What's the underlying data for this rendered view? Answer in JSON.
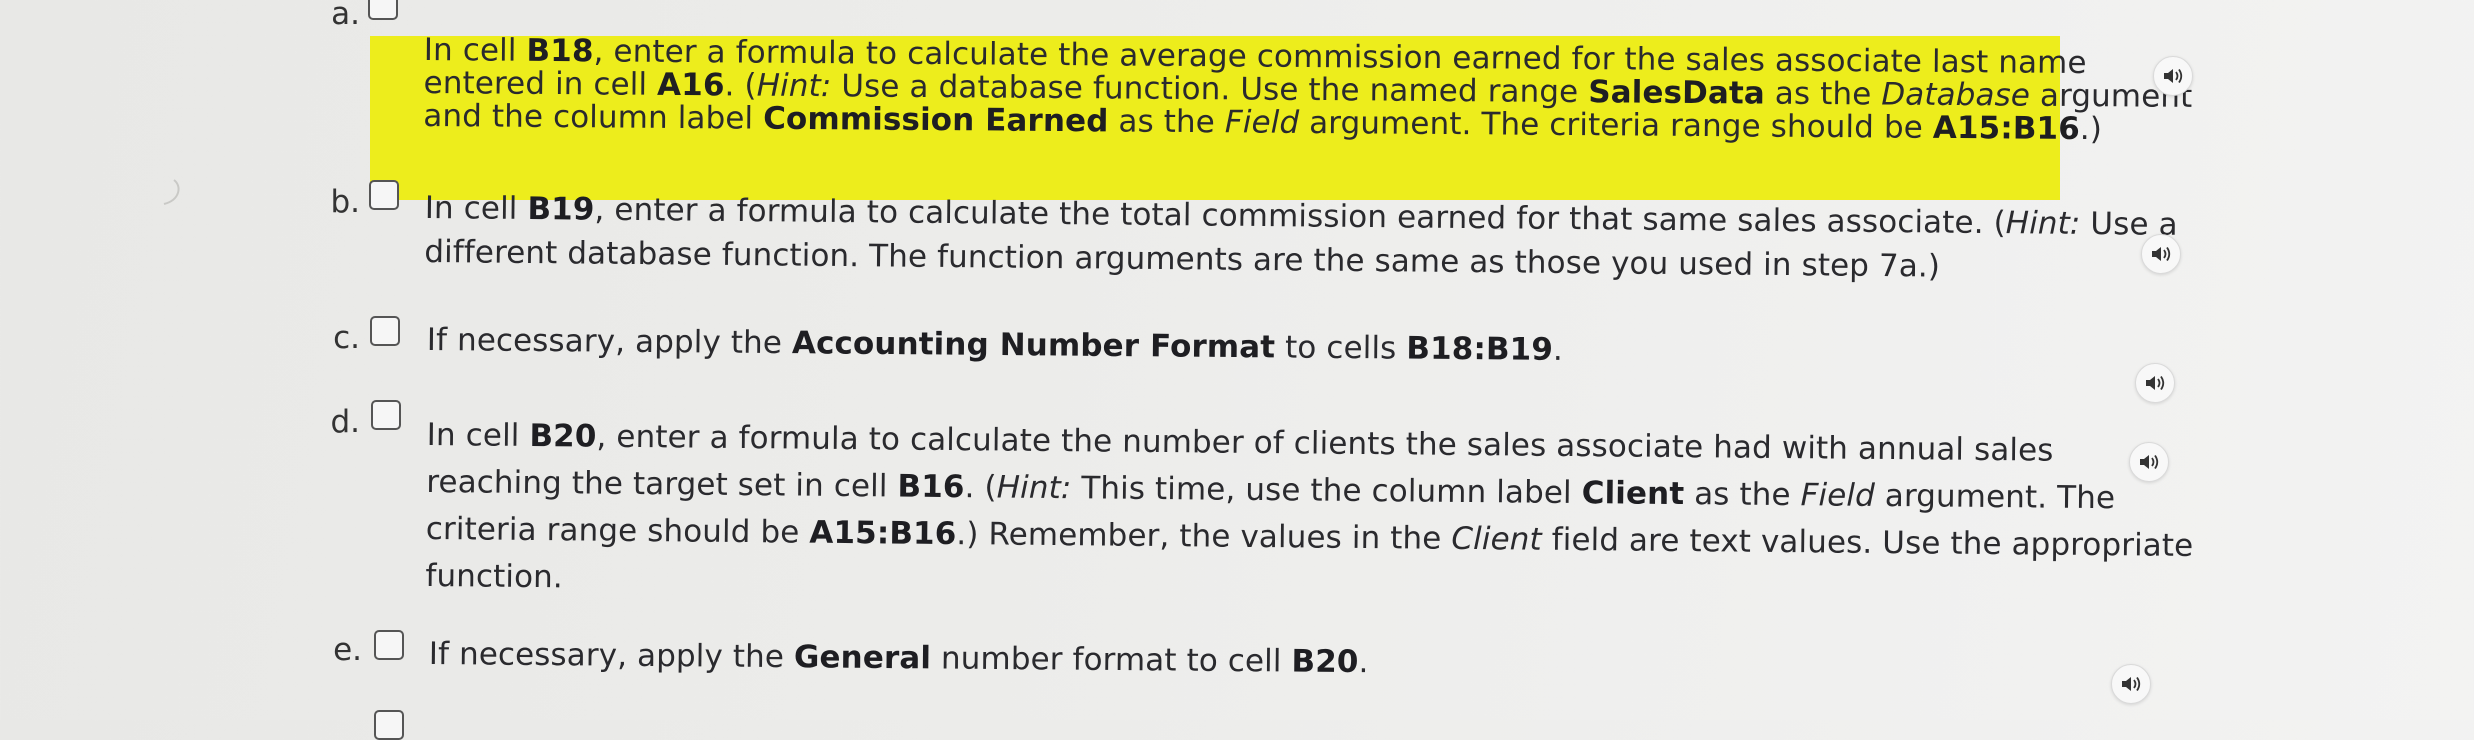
{
  "steps": [
    {
      "marker": "a.",
      "parts": [
        {
          "t": "In cell "
        },
        {
          "t": "B18",
          "b": true
        },
        {
          "t": ", enter a formula to calculate the average commission earned for the sales associate last name"
        },
        {
          "br": true
        },
        {
          "t": "entered in cell "
        },
        {
          "t": "A16",
          "b": true
        },
        {
          "t": ". ("
        },
        {
          "t": "Hint:",
          "i": true
        },
        {
          "t": " Use a database function. Use the named range "
        },
        {
          "t": "SalesData",
          "b": true
        },
        {
          "t": " as the "
        },
        {
          "t": "Database",
          "i": true
        },
        {
          "t": " argument"
        },
        {
          "br": true
        },
        {
          "t": "and the column label "
        },
        {
          "t": "Commission Earned",
          "b": true
        },
        {
          "t": " as the "
        },
        {
          "t": "Field",
          "i": true
        },
        {
          "t": " argument. The criteria range should be "
        },
        {
          "t": "A15:B16",
          "b": true
        },
        {
          "t": ".)"
        }
      ]
    },
    {
      "marker": "b.",
      "parts": [
        {
          "t": "In cell "
        },
        {
          "t": "B19",
          "b": true
        },
        {
          "t": ", enter a formula to calculate the total commission earned for that same sales associate. ("
        },
        {
          "t": "Hint:",
          "i": true
        },
        {
          "t": " Use a"
        },
        {
          "br": true
        },
        {
          "t": "different database function. The function arguments are the same as those you used in step 7a.)"
        }
      ]
    },
    {
      "marker": "c.",
      "parts": [
        {
          "t": "If necessary, apply the "
        },
        {
          "t": "Accounting Number Format",
          "b": true
        },
        {
          "t": " to cells "
        },
        {
          "t": "B18:B19",
          "b": true
        },
        {
          "t": "."
        }
      ]
    },
    {
      "marker": "d.",
      "parts": [
        {
          "t": "In cell "
        },
        {
          "t": "B20",
          "b": true
        },
        {
          "t": ", enter a formula to calculate the number of clients the sales associate had with annual sales"
        },
        {
          "br": true
        },
        {
          "t": "reaching the target set in cell "
        },
        {
          "t": "B16",
          "b": true
        },
        {
          "t": ". ("
        },
        {
          "t": "Hint:",
          "i": true
        },
        {
          "t": " This time, use the column label "
        },
        {
          "t": "Client",
          "b": true
        },
        {
          "t": " as the "
        },
        {
          "t": "Field",
          "i": true
        },
        {
          "t": " argument. The"
        },
        {
          "br": true
        },
        {
          "t": "criteria range should be "
        },
        {
          "t": "A15:B16",
          "b": true
        },
        {
          "t": ".) Remember, the values in the "
        },
        {
          "t": "Client",
          "i": true
        },
        {
          "t": " field are text values. Use the appropriate"
        },
        {
          "br": true
        },
        {
          "t": "function."
        }
      ]
    },
    {
      "marker": "e.",
      "parts": [
        {
          "t": "If necessary, apply the "
        },
        {
          "t": "General",
          "b": true
        },
        {
          "t": " number format to cell "
        },
        {
          "t": "B20",
          "b": true
        },
        {
          "t": "."
        }
      ]
    }
  ],
  "audio_icon": "speaker-icon",
  "colors": {
    "highlight": "#eded1c",
    "text": "#2a2a2e",
    "background": "#ececea"
  }
}
